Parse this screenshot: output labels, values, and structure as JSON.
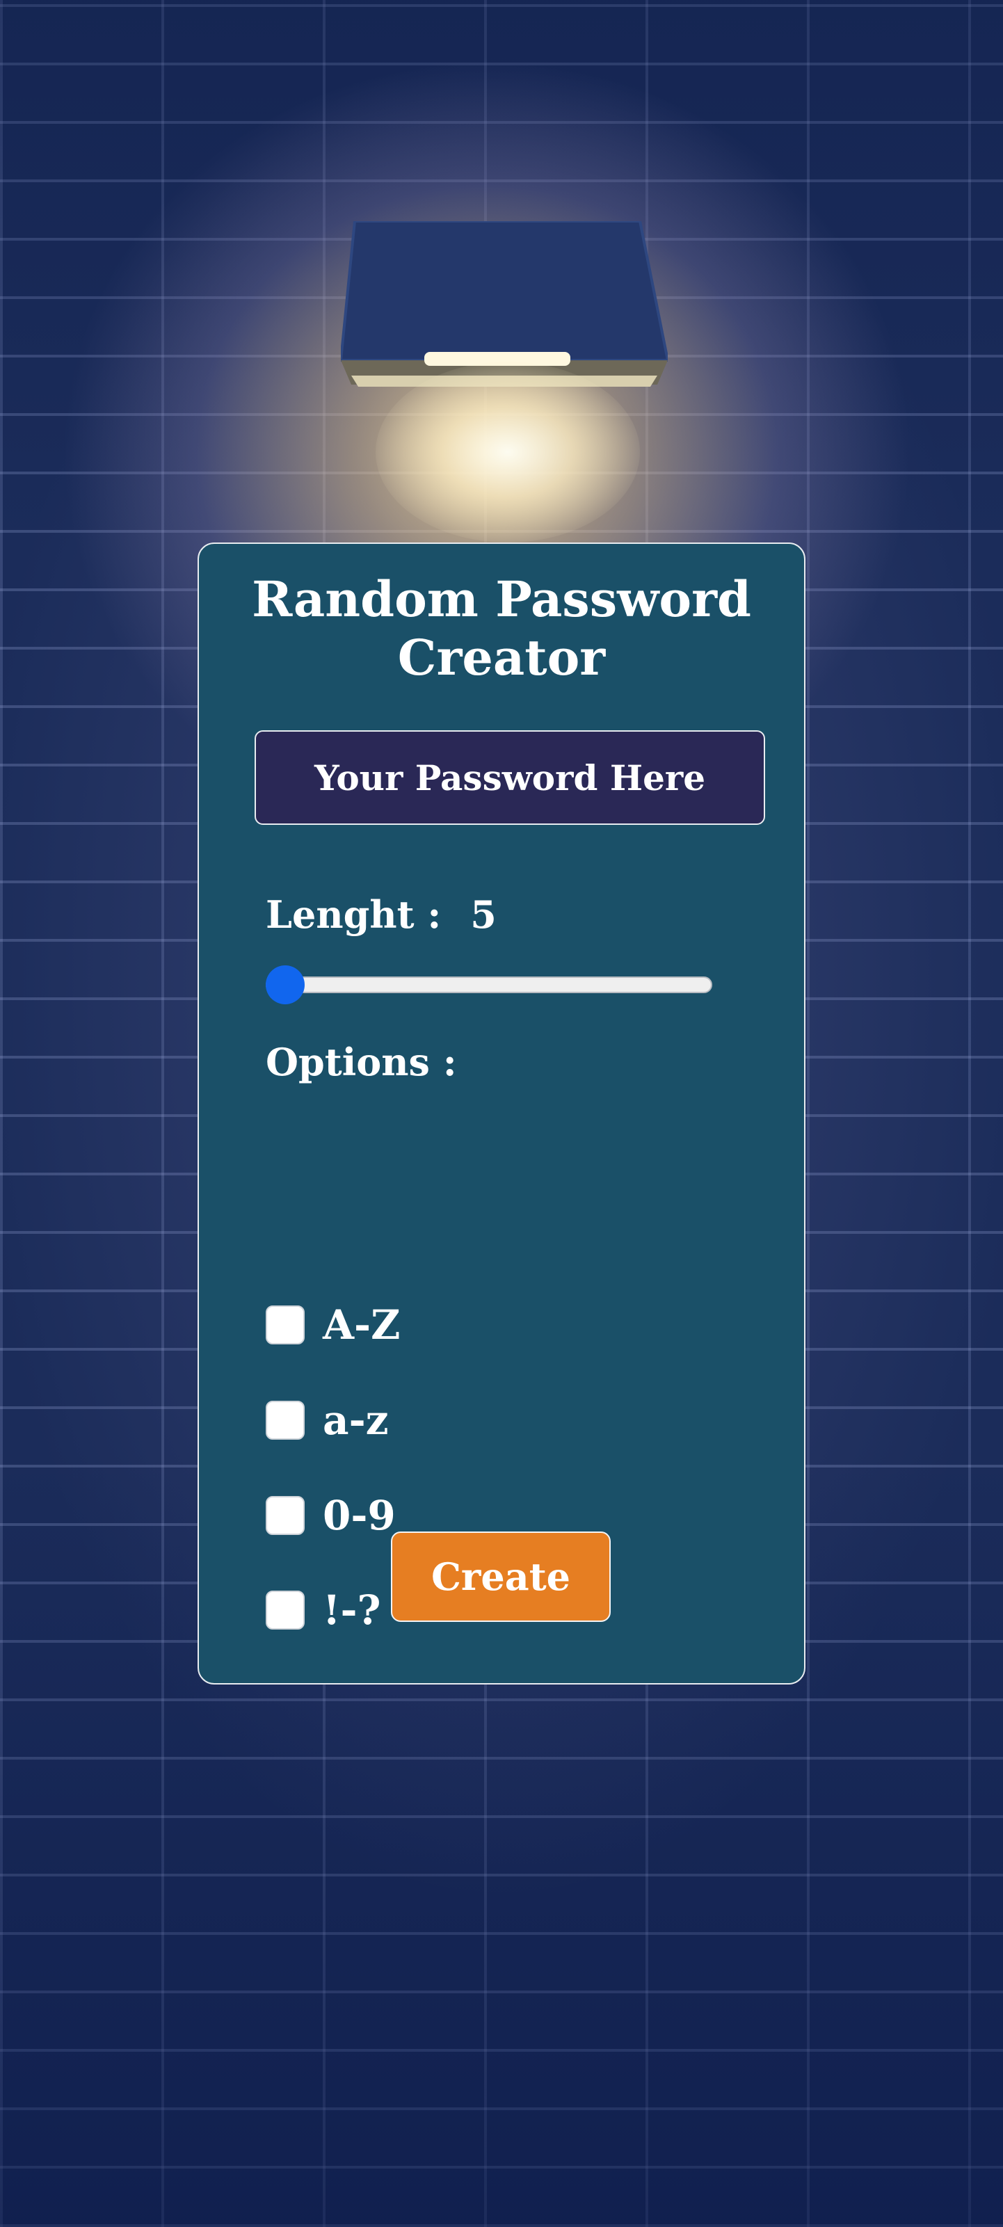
{
  "app": {
    "title": "Random Password Creator"
  },
  "password": {
    "display": "Your Password Here"
  },
  "length": {
    "label": "Lenght :",
    "value": "5",
    "slider_fraction": 0.0
  },
  "options": {
    "label": "Options :",
    "items": [
      {
        "label": "A-Z",
        "checked": false
      },
      {
        "label": "a-z",
        "checked": false
      },
      {
        "label": "0-9",
        "checked": false
      },
      {
        "label": "!-?",
        "checked": false
      }
    ]
  },
  "actions": {
    "create_label": "Create"
  },
  "colors": {
    "card": "#1a5068",
    "display": "#2a2856",
    "accent_button": "#e67e22",
    "slider_thumb": "#1166ee",
    "background": "#1b2c5a"
  },
  "icons": {
    "lamp": "wall-lamp-icon"
  }
}
